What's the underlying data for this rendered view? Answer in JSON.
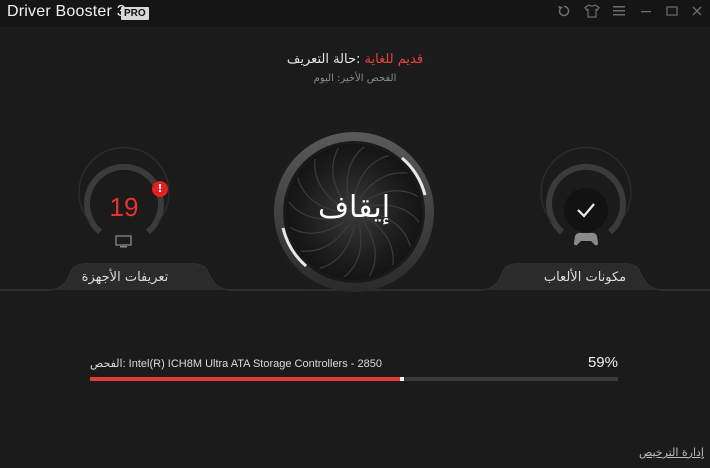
{
  "titlebar": {
    "app_name": "Driver Booster 3",
    "badge": "PRO",
    "buttons": {
      "undo_icon": "undo-icon",
      "shirt_icon": "tshirt-icon",
      "menu_icon": "menu-icon",
      "minimize_icon": "minimize-icon",
      "maximize_icon": "maximize-icon",
      "close_icon": "close-icon"
    }
  },
  "status": {
    "label": ":حالة التعريف",
    "value": "قديم للغاية",
    "last_scan": "الفحص الأخير: اليوم"
  },
  "left_gauge": {
    "count": "19",
    "alert_mark": "!",
    "label": "تعريفات الأجهزة",
    "icon": "monitor-icon"
  },
  "center": {
    "stop_label": "إيقاف"
  },
  "right_gauge": {
    "label": "مكونات الألعاب",
    "icons": [
      "check-icon",
      "gamepad-icon"
    ]
  },
  "scan": {
    "item_text": "الفحص: Intel(R) ICH8M Ultra ATA Storage Controllers - 2850",
    "percent_text": "59%",
    "progress": 0.59
  },
  "footer": {
    "license_link": "إدارة الترخيص"
  },
  "colors": {
    "accent": "#e03a3a",
    "background": "#1b1b1b",
    "titlebar": "#151515"
  }
}
